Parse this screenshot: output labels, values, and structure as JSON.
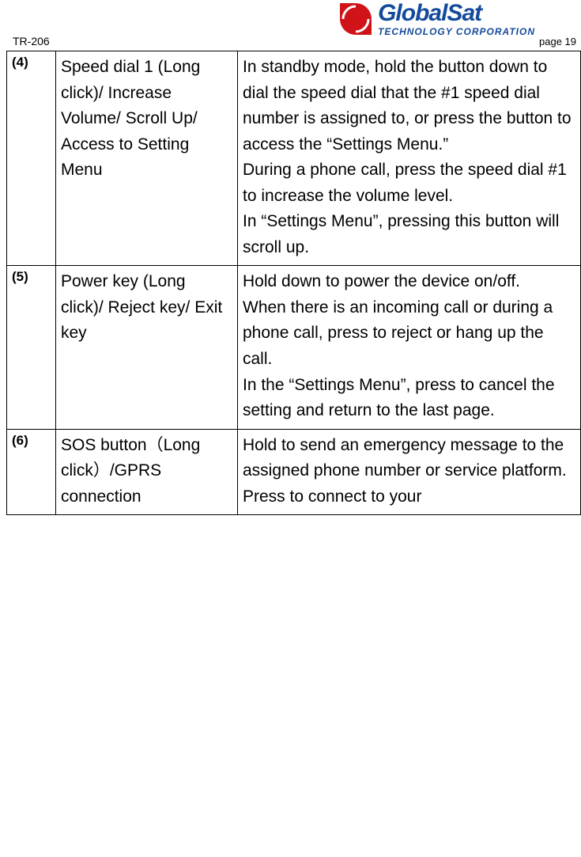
{
  "header": {
    "doc_id": "TR-206",
    "page_label": "page 19",
    "brand_main": "GlobalSat",
    "brand_sub": "TECHNOLOGY CORPORATION"
  },
  "rows": [
    {
      "num": "(4)",
      "name": "Speed dial 1 (Long click)/ Increase Volume/ Scroll Up/ Access to Setting Menu",
      "desc": "In standby mode, hold the button down to dial the speed dial that the #1 speed dial number is assigned to, or press the button to access the “Settings Menu.”\nDuring a phone call, press the speed dial #1 to increase the volume level.\nIn “Settings Menu”, pressing this button will scroll up."
    },
    {
      "num": "(5)",
      "name": "Power key (Long click)/ Reject key/ Exit key",
      "desc": "Hold down to power the device on/off.\nWhen there is an incoming call or during a phone call, press to reject or hang up the call.\nIn the “Settings Menu”, press to cancel the setting and return to the last page."
    },
    {
      "num": "(6)",
      "name": "SOS button（Long click）/GPRS connection",
      "desc": "Hold to send an emergency message to the assigned phone number or service platform.\nPress to connect to your"
    }
  ]
}
